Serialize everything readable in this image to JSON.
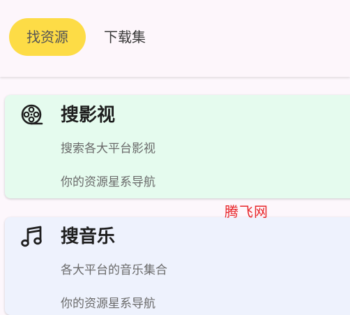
{
  "tabs": {
    "active": "找资源",
    "second": "下载集"
  },
  "cards": [
    {
      "icon": "film-reel-icon",
      "title": "搜影视",
      "subtitle": "搜索各大平台影视",
      "tagline": "你的资源星系导航",
      "bg_color": "#e5fbee"
    },
    {
      "icon": "music-note-icon",
      "title": "搜音乐",
      "subtitle": "各大平台的音乐集合",
      "tagline": "你的资源星系导航",
      "bg_color": "#eef2fd"
    }
  ],
  "watermark": "腾飞网",
  "colors": {
    "accent": "#fddc46",
    "watermark": "#e8262a"
  }
}
